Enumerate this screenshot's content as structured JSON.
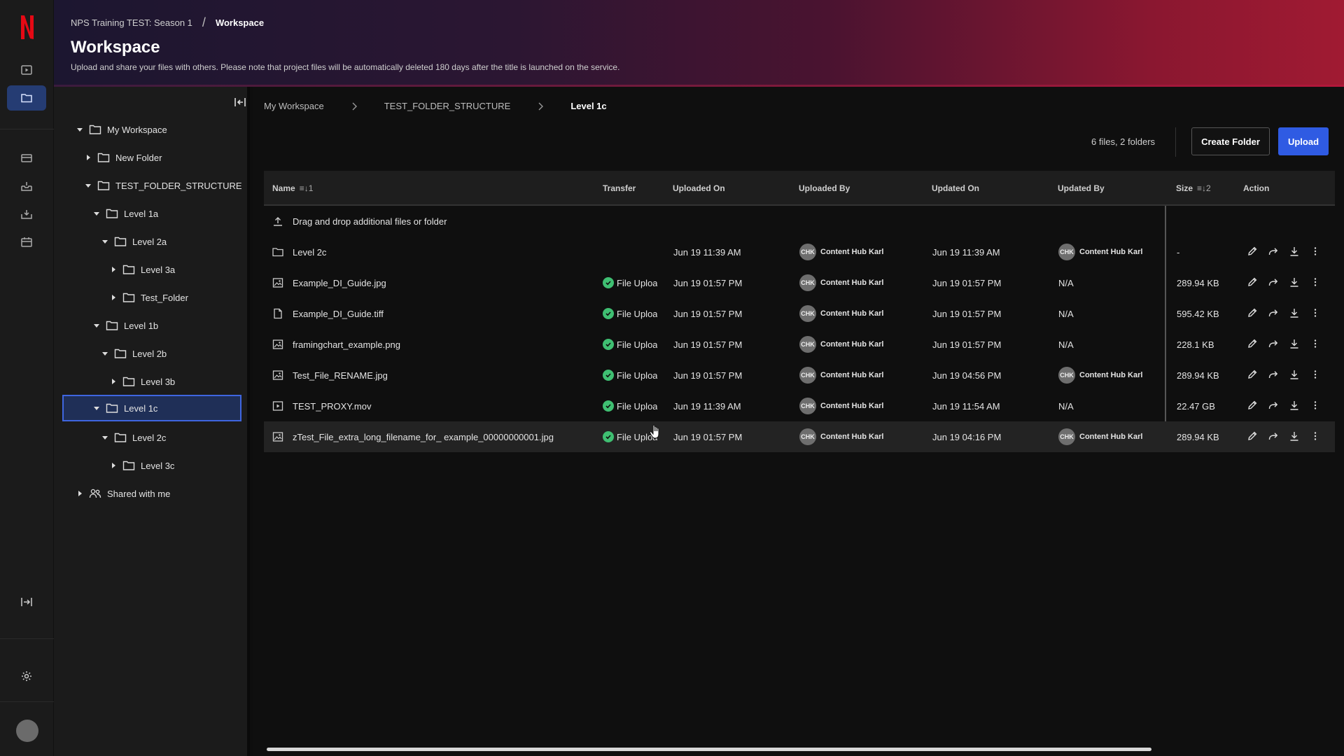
{
  "header": {
    "breadcrumb_project": "NPS Training TEST: Season 1",
    "breadcrumb_separator": "/",
    "breadcrumb_current": "Workspace",
    "title": "Workspace",
    "description": "Upload and share your files with others. Please note that project files will be automatically deleted 180 days after the title is launched on the service."
  },
  "rail": {
    "icons": [
      "netflix-logo",
      "play-icon",
      "folder-icon",
      "layout-icon",
      "inbox-icon",
      "download-box-icon",
      "calendar-icon",
      "expand-icon",
      "gear-icon"
    ],
    "active": "folder-icon"
  },
  "tree": {
    "items": [
      {
        "label": "My Workspace",
        "expanded": true,
        "level": 0
      },
      {
        "label": "New Folder",
        "expanded": false,
        "level": 1
      },
      {
        "label": "TEST_FOLDER_STRUCTURE",
        "expanded": true,
        "level": 1
      },
      {
        "label": "Level 1a",
        "expanded": true,
        "level": 2
      },
      {
        "label": "Level 2a",
        "expanded": true,
        "level": 3
      },
      {
        "label": "Level 3a",
        "expanded": false,
        "level": 4
      },
      {
        "label": "Test_Folder",
        "expanded": false,
        "level": 4
      },
      {
        "label": "Level 1b",
        "expanded": true,
        "level": 2
      },
      {
        "label": "Level 2b",
        "expanded": true,
        "level": 3
      },
      {
        "label": "Level 3b",
        "expanded": false,
        "level": 4
      },
      {
        "label": "Level 1c",
        "expanded": true,
        "level": 2,
        "selected": true
      },
      {
        "label": "Level 2c",
        "expanded": true,
        "level": 3
      },
      {
        "label": "Level 3c",
        "expanded": false,
        "level": 4
      },
      {
        "label": "Shared with me",
        "expanded": false,
        "level": 0
      }
    ]
  },
  "main": {
    "breadcrumb": [
      "My Workspace",
      "TEST_FOLDER_STRUCTURE",
      "Level 1c"
    ],
    "counts": "6 files, 2 folders",
    "create_folder_label": "Create Folder",
    "upload_label": "Upload",
    "columns": {
      "name": "Name",
      "name_sort": "≡↓1",
      "transfer": "Transfer",
      "uploaded_on": "Uploaded On",
      "uploaded_by": "Uploaded By",
      "updated_on": "Updated On",
      "updated_by": "Updated By",
      "size": "Size",
      "size_sort": "≡↓2",
      "action": "Action"
    },
    "dropzone_label": "Drag and drop additional files or folder",
    "user_initials": "CHK",
    "rows": [
      {
        "icon": "folder-icon",
        "name": "Level 2c",
        "transfer": "",
        "uploaded_on": "Jun 19 11:39 AM",
        "uploaded_by": "Content Hub Karl",
        "updated_on": "Jun 19 11:39 AM",
        "updated_by": "Content Hub Karl",
        "size": "-"
      },
      {
        "icon": "image-icon",
        "name": "Example_DI_Guide.jpg",
        "transfer": "File Uploaded",
        "uploaded_on": "Jun 19 01:57 PM",
        "uploaded_by": "Content Hub Karl",
        "updated_on": "Jun 19 01:57 PM",
        "updated_by": "N/A",
        "size": "289.94 KB"
      },
      {
        "icon": "document-icon",
        "name": "Example_DI_Guide.tiff",
        "transfer": "File Uploaded",
        "uploaded_on": "Jun 19 01:57 PM",
        "uploaded_by": "Content Hub Karl",
        "updated_on": "Jun 19 01:57 PM",
        "updated_by": "N/A",
        "size": "595.42 KB"
      },
      {
        "icon": "image-icon",
        "name": "framingchart_example.png",
        "transfer": "File Uploaded",
        "uploaded_on": "Jun 19 01:57 PM",
        "uploaded_by": "Content Hub Karl",
        "updated_on": "Jun 19 01:57 PM",
        "updated_by": "N/A",
        "size": "228.1 KB"
      },
      {
        "icon": "image-icon",
        "name": "Test_File_RENAME.jpg",
        "transfer": "File Uploaded",
        "uploaded_on": "Jun 19 01:57 PM",
        "uploaded_by": "Content Hub Karl",
        "updated_on": "Jun 19 04:56 PM",
        "updated_by": "Content Hub Karl",
        "size": "289.94 KB"
      },
      {
        "icon": "video-icon",
        "name": "TEST_PROXY.mov",
        "transfer": "File Uploaded",
        "uploaded_on": "Jun 19 11:39 AM",
        "uploaded_by": "Content Hub Karl",
        "updated_on": "Jun 19 11:54 AM",
        "updated_by": "N/A",
        "size": "22.47 GB"
      },
      {
        "icon": "image-icon",
        "name": "zTest_File_extra_long_filename_for_ example_00000000001.jpg",
        "transfer": "File Uploaded",
        "uploaded_on": "Jun 19 01:57 PM",
        "uploaded_by": "Content Hub Karl",
        "updated_on": "Jun 19 04:16 PM",
        "updated_by": "Content Hub Karl",
        "size": "289.94 KB",
        "hover": true
      }
    ]
  }
}
